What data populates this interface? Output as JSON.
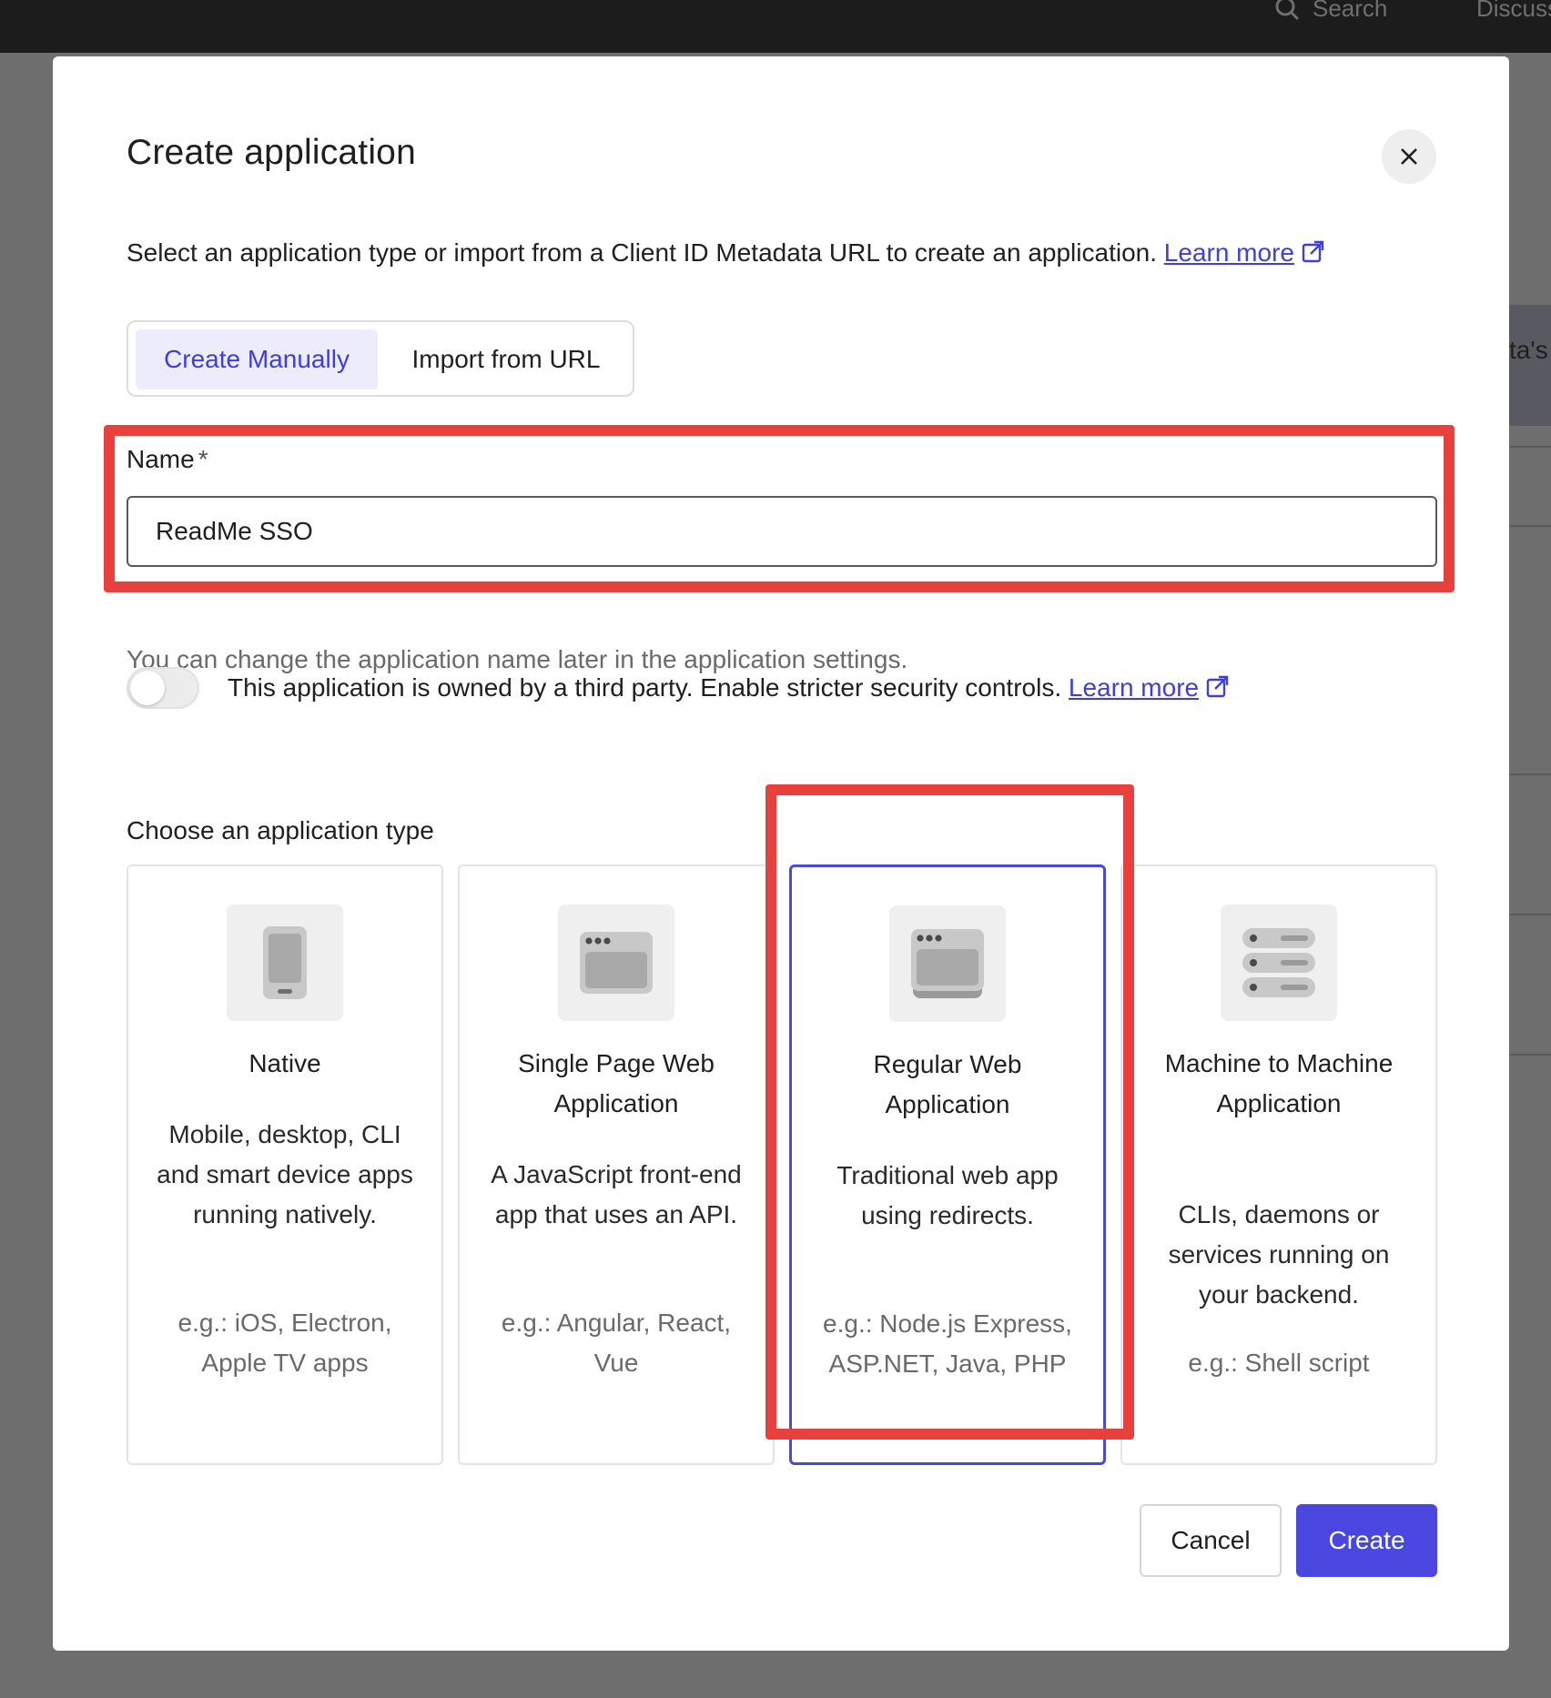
{
  "topbar": {
    "search_label": "Search",
    "discuss_label": "Discuss",
    "icons": {
      "search": "search-icon"
    }
  },
  "background": {
    "peek_text": "ta's"
  },
  "modal": {
    "title": "Create application",
    "close_icon": "close-icon",
    "description": "Select an application type or import from a Client ID Metadata URL to create an application.",
    "description_link": "Learn more",
    "tabs": [
      {
        "label": "Create Manually",
        "active": true
      },
      {
        "label": "Import from URL",
        "active": false
      }
    ],
    "name_field": {
      "label": "Name",
      "required_mark": "*",
      "value": "ReadMe SSO",
      "hint": "You can change the application name later in the application settings."
    },
    "third_party": {
      "enabled": false,
      "text": "This application is owned by a third party. Enable stricter security controls.",
      "link": "Learn more"
    },
    "type_section_label": "Choose an application type",
    "app_types": [
      {
        "title": "Native",
        "desc": "Mobile, desktop, CLI and smart device apps running natively.",
        "example": "e.g.: iOS, Electron, Apple TV apps",
        "icon": "mobile-device-icon",
        "selected": false
      },
      {
        "title": "Single Page Web Application",
        "desc": "A JavaScript front-end app that uses an API.",
        "example": "e.g.: Angular, React, Vue",
        "icon": "browser-window-icon",
        "selected": false
      },
      {
        "title": "Regular Web Application",
        "desc": "Traditional web app using redirects.",
        "example": "e.g.: Node.js Express, ASP.NET, Java, PHP",
        "icon": "web-server-window-icon",
        "selected": true
      },
      {
        "title": "Machine to Machine Application",
        "desc": "CLIs, daemons or services running on your backend.",
        "example": "e.g.: Shell script",
        "icon": "server-stack-icon",
        "selected": false
      }
    ],
    "buttons": {
      "cancel": "Cancel",
      "create": "Create"
    }
  },
  "colors": {
    "accent": "#4a47e0",
    "link": "#3f3fd8",
    "annotation": "#e8403c",
    "overlay": "#6e6e6e"
  }
}
